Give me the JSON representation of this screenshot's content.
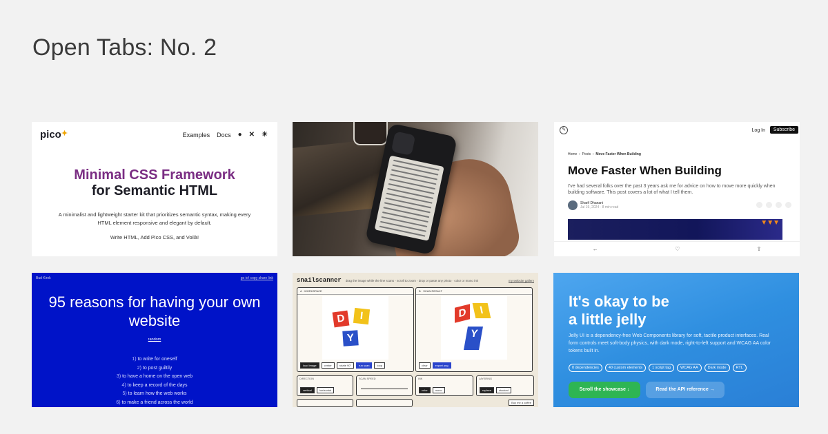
{
  "page": {
    "title": "Open Tabs: No. 2"
  },
  "tabs": [
    {
      "logo": "pico",
      "nav": {
        "examples": "Examples",
        "docs": "Docs"
      },
      "headline_1": "Minimal CSS Framework",
      "headline_2": "for Semantic HTML",
      "description": "A minimalist and lightweight starter kit that prioritizes semantic syntax, making every HTML element responsive and elegant by default.",
      "tagline": "Write HTML, Add Pico CSS, and Voilà!"
    },
    {
      "description": ""
    },
    {
      "login": "Log In",
      "subscribe": "Subscribe",
      "breadcrumb": {
        "home": "Home",
        "posts": "Posts",
        "current": "Move Faster When Building"
      },
      "title": "Move Faster When Building",
      "excerpt": "I've had several folks over the past 3 years ask me for advice on how to move more quickly when building software. This post covers a lot of what I tell them.",
      "author": "Sharif Dhanani",
      "meta": "Jul 19, 2024 · 8 min read"
    },
    {
      "site": "Bud Kirok",
      "links": "go to!  copy share link",
      "title": "95 reasons for having your own website",
      "random": "random",
      "reasons": [
        {
          "n": "1)",
          "text": "to write for oneself"
        },
        {
          "n": "2)",
          "text": "to post guiltily"
        },
        {
          "n": "3)",
          "text": "to have a home on the open web"
        },
        {
          "n": "4)",
          "text": "to keep a record of the days"
        },
        {
          "n": "5)",
          "text": "to learn how the web works"
        },
        {
          "n": "6)",
          "text": "to make a friend across the world"
        }
      ]
    },
    {
      "logo": "snailscanner",
      "hint": "drag the image while the line scans · scroll to zoom · drop or paste any photo · color or mono ink",
      "link": "my website gallery",
      "panel_a": "A · WORKSPACE",
      "panel_b": "B · SCAN RESULT",
      "tile_letters": [
        "D",
        "I",
        "Y"
      ],
      "buttons_a": [
        "load image",
        "center",
        "rotate 90°",
        "run scan",
        "loop"
      ],
      "buttons_b": [
        "clear",
        "export png"
      ],
      "direction": "DIRECTION",
      "dir_opts": [
        "vertical",
        "horizontal"
      ],
      "scan_speed": "SCAN SPEED",
      "ink": "INK",
      "ink_opts": [
        "color",
        "mono"
      ],
      "layering": "LAYERING",
      "layer_opts": [
        "replace",
        "stacked"
      ],
      "coffee": "Buy me a coffee"
    },
    {
      "title_1": "It's okay to be",
      "title_2": "a little jelly",
      "description": "Jelly UI is a dependency-free Web Components library for soft, tactile product interfaces. Real form controls meet soft-body physics, with dark mode, right-to-left support and WCAG AA color tokens built in.",
      "tags": [
        "0 dependencies",
        "40 custom elements",
        "1 script tag",
        "WCAG AA",
        "Dark mode",
        "RTL"
      ],
      "cta_primary": "Scroll the showcase ↓",
      "cta_secondary": "Read the API reference →"
    }
  ]
}
